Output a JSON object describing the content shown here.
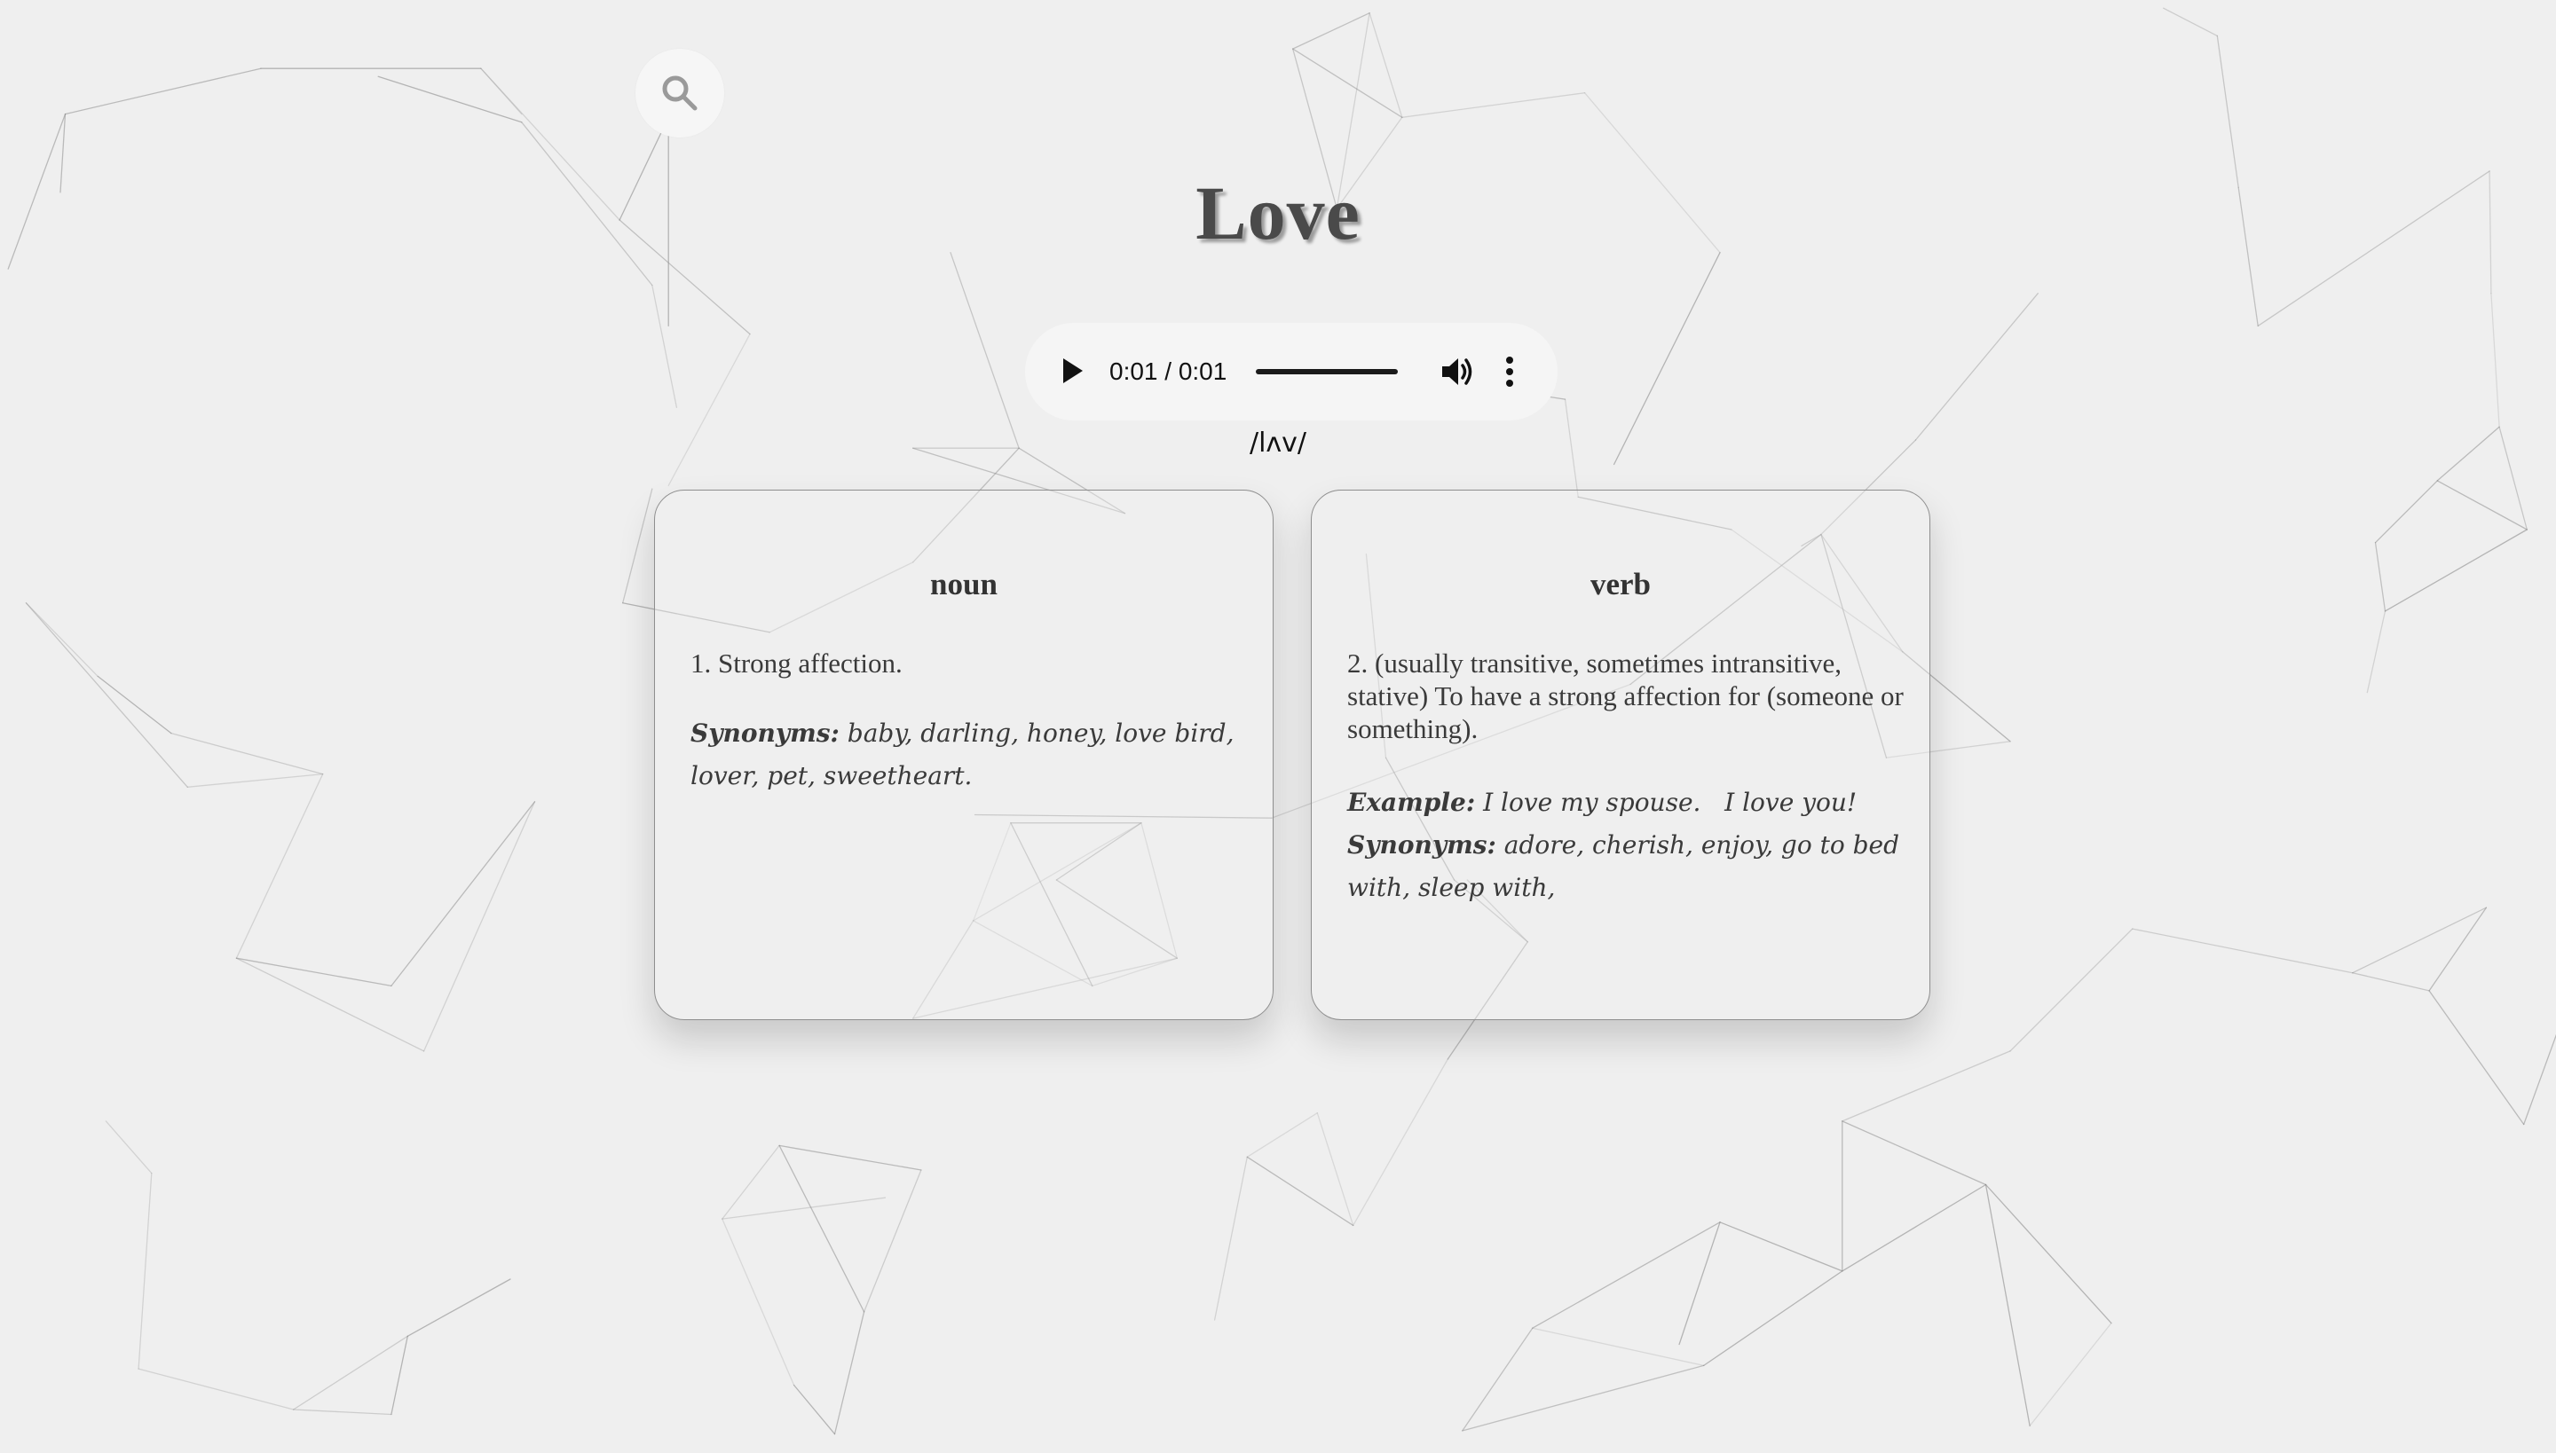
{
  "page": {
    "word": "Love",
    "phonetic": "/lʌv/"
  },
  "search": {
    "icon": "search-icon"
  },
  "audio": {
    "time_display": "0:01 / 0:01",
    "progress": 1.0,
    "play_icon": "play-icon",
    "volume_icon": "volume-icon",
    "menu_icon": "more-vert-icon"
  },
  "meanings": [
    {
      "part_of_speech": "noun",
      "definition": "1. Strong affection.",
      "synonyms_label": "Synonyms:",
      "synonyms": "baby, darling, honey, love bird, lover, pet, sweetheart."
    },
    {
      "part_of_speech": "verb",
      "definition": "2. (usually transitive, sometimes intransitive, stative) To have a strong affection for (someone or something).",
      "example_label": "Example:",
      "example": "I love my spouse.   I love you!",
      "synonyms_label": "Synonyms:",
      "synonyms": "adore, cherish, enjoy, go to bed with, sleep with,"
    }
  ],
  "colors": {
    "background": "#efefef",
    "text": "#3a3a3a",
    "card_border": "#8e8e8e",
    "network_lines": "#8a8a8a"
  }
}
